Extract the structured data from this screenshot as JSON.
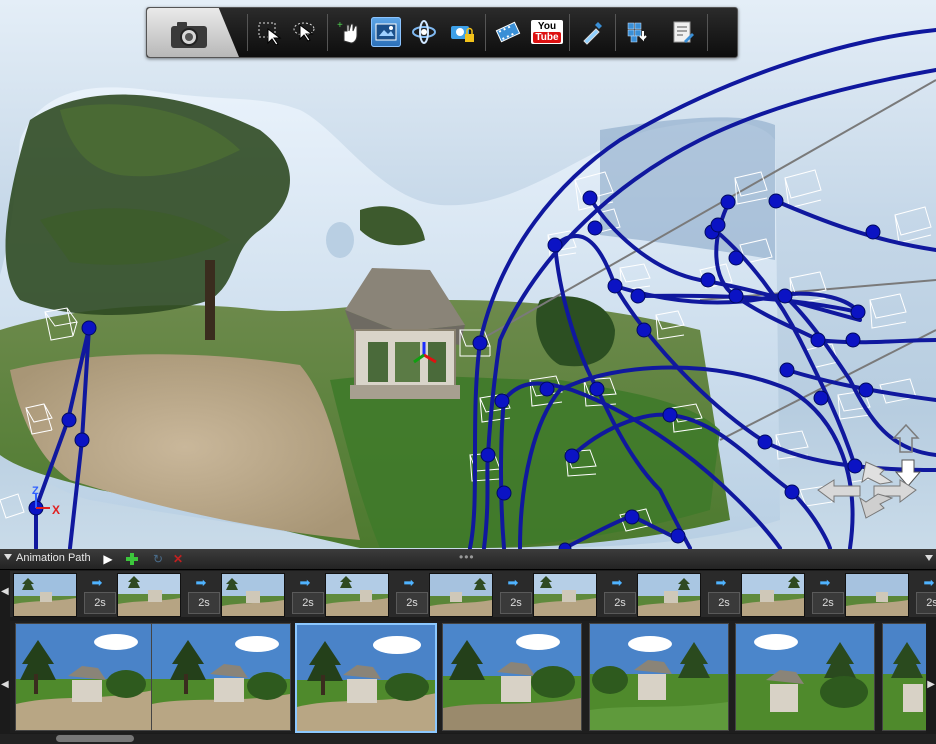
{
  "toolbar": {
    "icons": [
      "camera-icon",
      "select-rectangle-icon",
      "select-lasso-icon",
      "add-point-hand-icon",
      "viewpoint-icon",
      "orbit-icon",
      "locked-camera-icon",
      "film-icon",
      "youtube-icon",
      "eyedropper-icon",
      "export-cube-icon",
      "settings-document-icon"
    ],
    "youtube_you": "You",
    "youtube_tube": "Tube"
  },
  "viewport": {
    "axis_z": "Z",
    "axis_x": "X"
  },
  "panel": {
    "title": "Animation Path",
    "path_keyframes": [
      {
        "duration": "2s"
      },
      {
        "duration": "2s"
      },
      {
        "duration": "2s"
      },
      {
        "duration": "2s"
      },
      {
        "duration": "2s"
      },
      {
        "duration": "2s"
      },
      {
        "duration": "2s"
      },
      {
        "duration": "2s"
      },
      {
        "duration": "2s"
      }
    ],
    "view_frames": 7,
    "selected_view_frame": 2
  },
  "colors": {
    "path_blue": "#10189e",
    "selection_blue": "#8cc8ff",
    "add_green": "#3cc63c",
    "delete_red": "#c02020"
  }
}
